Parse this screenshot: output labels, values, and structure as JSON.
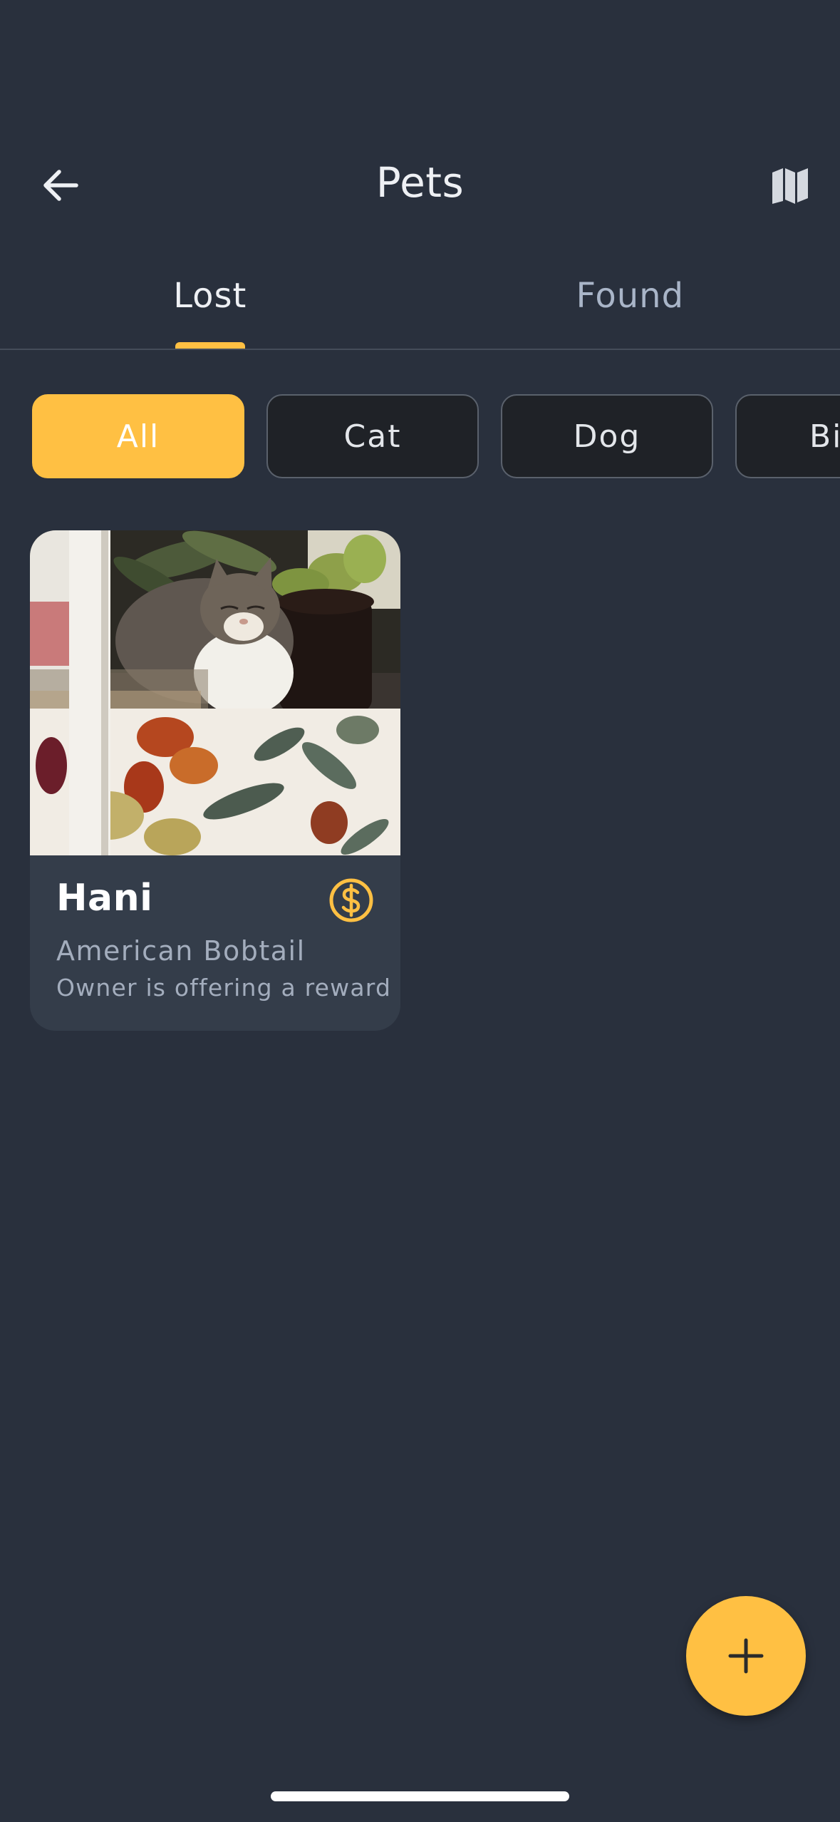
{
  "header": {
    "title": "Pets",
    "back_icon": "arrow-left-icon",
    "map_icon": "map-icon"
  },
  "tabs": [
    {
      "label": "Lost",
      "active": true
    },
    {
      "label": "Found",
      "active": false
    }
  ],
  "filters": {
    "chips": [
      {
        "label": "All",
        "selected": true
      },
      {
        "label": "Cat",
        "selected": false
      },
      {
        "label": "Dog",
        "selected": false
      },
      {
        "label": "Bi",
        "selected": false
      }
    ]
  },
  "pets": [
    {
      "name": "Hani",
      "breed": "American Bobtail",
      "note": "Owner is offering a reward",
      "badge_icon": "dollar-coin-icon",
      "photo_icon": "cat-photo"
    }
  ],
  "fab": {
    "icon": "plus-icon"
  },
  "colors": {
    "background": "#29303d",
    "accent": "#ffc043",
    "card": "#343d4a",
    "chip_dark": "#1f2227",
    "text_primary": "#eef0f4",
    "text_secondary": "#a3adbd"
  }
}
